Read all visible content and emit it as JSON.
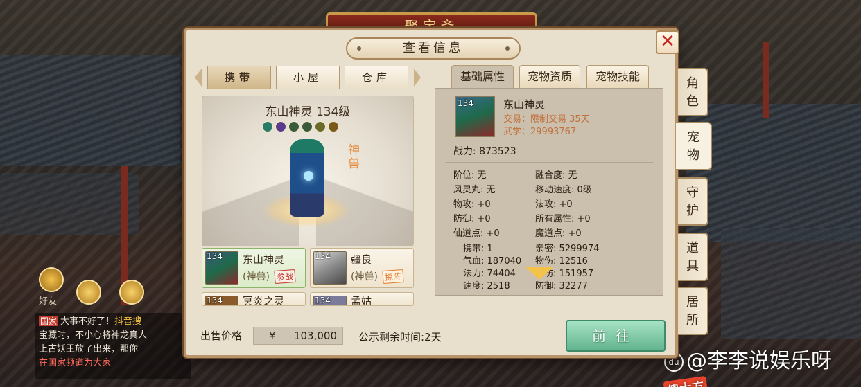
{
  "background": {
    "top_sign": "聚宝斋",
    "friend_label": "好友",
    "chat_lines": [
      {
        "tag": "国家",
        "text": "大事不好了！",
        "highlight": "抖音搜"
      },
      {
        "text": "宝藏时，不小心将神龙真人"
      },
      {
        "text": "上古妖王放了出来，那你"
      },
      {
        "text": "在国家频道为大家"
      }
    ],
    "watermark_text": "@李李说娱乐呀",
    "watermark_logo": "du",
    "watermark_badge": "傻大方"
  },
  "dialog": {
    "title": "查看信息",
    "close_icon": "close-x-icon",
    "location_tabs": [
      "携带",
      "小屋",
      "仓库"
    ],
    "active_location_tab": 0,
    "info_tabs": [
      "基础属性",
      "宠物资质",
      "宠物技能"
    ],
    "active_info_tab": 0,
    "portrait": {
      "name_level": "东山神灵 134级",
      "side_tag": "神兽",
      "attribute_icons": [
        "water-icon",
        "purple-gem-icon",
        "wind-icon",
        "wind-icon",
        "feather-icon",
        "seal-icon"
      ]
    },
    "pets": [
      {
        "level": "134",
        "name": "东山神灵",
        "type": "(神兽)",
        "badge": "参战",
        "badge_color": "#c0392b",
        "selected": true
      },
      {
        "level": "134",
        "name": "疆良",
        "type": "(神兽)",
        "badge": "掠阵",
        "badge_color": "#e07b2a",
        "selected": false
      },
      {
        "level": "134",
        "name": "冥炎之灵",
        "type": "",
        "badge": "",
        "selected": false
      },
      {
        "level": "134",
        "name": "孟姑",
        "type": "",
        "badge": "",
        "selected": false
      }
    ],
    "basic_info": {
      "thumb_level": "134",
      "name": "东山神灵",
      "trade": "交易：限制交易 35天",
      "wuxue": "武学：29993767",
      "power": "战力: 873523",
      "attrs": [
        [
          "阶位: 无",
          "融合度: 无"
        ],
        [
          "风灵丸: 无",
          "移动速度: 0级"
        ],
        [
          "物攻: +0",
          "法攻: +0"
        ],
        [
          "防御: +0",
          "所有属性: +0"
        ],
        [
          "仙道点: +0",
          "魔道点: +0"
        ]
      ],
      "stats": [
        [
          "携带: 1",
          "亲密: 5299974"
        ],
        [
          "气血: 187040",
          "物伤: 12516"
        ],
        [
          "法力: 74404",
          "法伤: 151957"
        ],
        [
          "速度: 2518",
          "防御: 32277"
        ]
      ]
    },
    "sale_label": "出售价格",
    "currency_symbol": "¥",
    "price": "103,000",
    "remain_time": "公示剩余时间:2天",
    "go_button": "前往"
  },
  "side_tabs": [
    "角色",
    "宠物",
    "守护",
    "道具",
    "居所"
  ],
  "active_side_tab": 1
}
